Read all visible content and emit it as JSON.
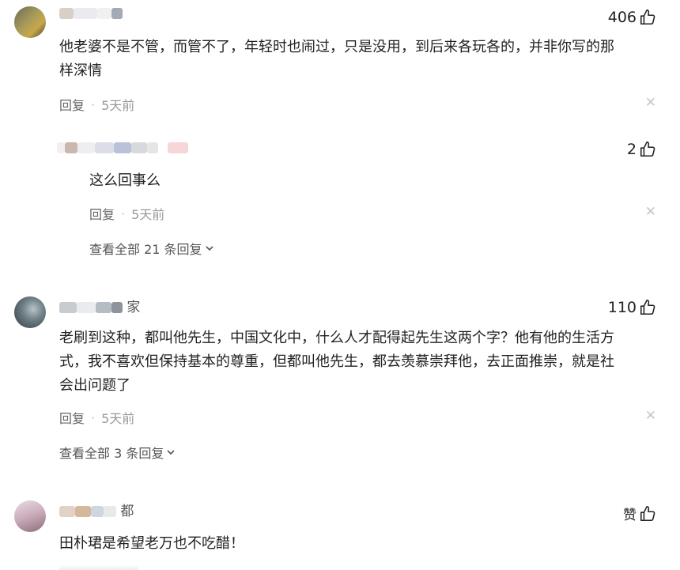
{
  "comments": [
    {
      "username": "",
      "likes": "406",
      "text_line1": "他老婆不是不管，而管不了，年轻时也闹过，只是没用，到后来各玩各的，并非你写的那",
      "text_line2": "样深情",
      "reply_label": "回复",
      "time": "5天前",
      "reply": {
        "username": "",
        "likes": "2",
        "text": "这么回事么",
        "reply_label": "回复",
        "time": "5天前"
      },
      "view_all": "查看全部 21 条回复"
    },
    {
      "username": "家",
      "likes": "110",
      "text_line1": "老刷到这种，都叫他先生，中国文化中，什么人才配得起先生这两个字？他有他的生活方",
      "text_line2": "式，我不喜欢但保持基本的尊重，但都叫他先生，都去羡慕崇拜他，去正面推崇，就是社",
      "text_line3": "会出问题了",
      "reply_label": "回复",
      "time": "5天前",
      "view_all": "查看全部 3 条回复"
    },
    {
      "username": "都",
      "likes": "赞",
      "text_line1": "田朴珺是希望老万也不吃醋！"
    }
  ],
  "icons": {
    "like": "thumbs-up-icon",
    "close": "close-icon",
    "chevron": "chevron-down-icon"
  },
  "colors": {
    "text": "#222222",
    "meta": "#999999",
    "close": "#c6c6c6"
  }
}
